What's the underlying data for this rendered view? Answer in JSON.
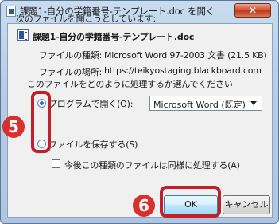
{
  "dialog": {
    "title": "課題1-自分の学籍番号-テンプレート.doc を開く",
    "close_glyph": "✕",
    "prompt": "次のファイルを開こうとしています:",
    "file_name": "課題1-自分の学籍番号-テンプレート.doc",
    "file_type_label": "ファイルの種類:",
    "file_type_value": "Microsoft Word 97-2003 文書 (21.5 KB)",
    "file_location_label": "ファイルの場所:",
    "file_location_value": "https://teikyostaging.blackboard.com",
    "question": "このファイルをどのように処理するか選んでください",
    "open_with_label": "プログラムで開く(O):",
    "open_with_program": "Microsoft Word (既定)",
    "save_file_label": "ファイルを保存する(S)",
    "remember_label": "今後この種類のファイルは同様に処理する(A)",
    "ok_label": "OK",
    "cancel_label": "キャンセル",
    "open_with_selected": true,
    "remember_checked": false
  },
  "annotations": {
    "step5": "5",
    "step6": "6",
    "color": "#d9302b"
  }
}
